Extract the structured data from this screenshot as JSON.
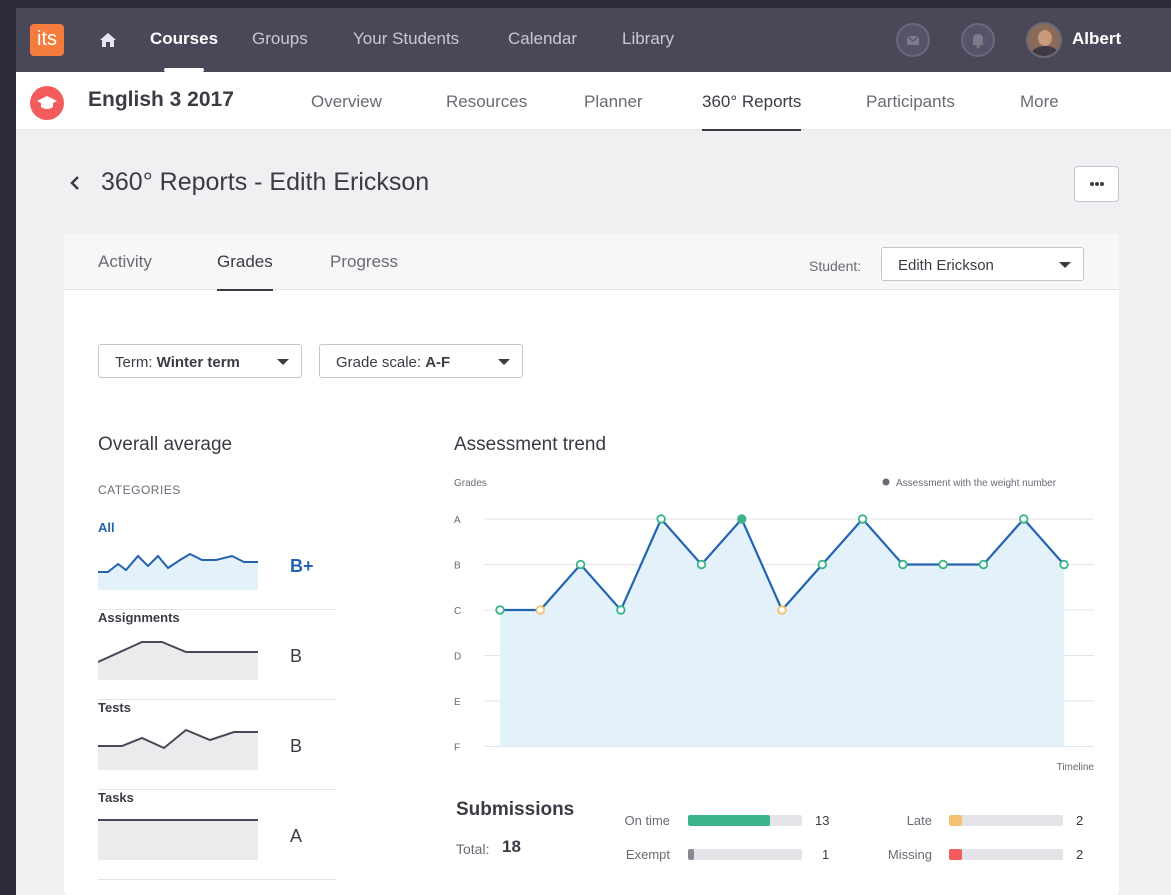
{
  "nav": {
    "logo": "its",
    "links": [
      "Courses",
      "Groups",
      "Your Students",
      "Calendar",
      "Library"
    ],
    "active": "Courses",
    "user": "Albert"
  },
  "course": {
    "title": "English 3 2017",
    "tabs": [
      "Overview",
      "Resources",
      "Planner",
      "360° Reports",
      "Participants",
      "More"
    ],
    "active": "360° Reports"
  },
  "page": {
    "title": "360° Reports - Edith Erickson"
  },
  "report_tabs": [
    "Activity",
    "Grades",
    "Progress"
  ],
  "report_active": "Grades",
  "student": {
    "label": "Student:",
    "value": "Edith Erickson"
  },
  "filters": {
    "term_label": "Term:",
    "term_value": "Winter term",
    "scale_label": "Grade scale:",
    "scale_value": "A-F"
  },
  "overall": {
    "title": "Overall average",
    "caption": "CATEGORIES",
    "categories": [
      {
        "name": "All",
        "grade": "B+"
      },
      {
        "name": "Assignments",
        "grade": "B"
      },
      {
        "name": "Tests",
        "grade": "B"
      },
      {
        "name": "Tasks",
        "grade": "A"
      }
    ]
  },
  "colors": {
    "accent_blue": "#2463b0",
    "on_time": "#3ab58a",
    "late": "#f5c272",
    "missing": "#f25c5c",
    "exempt": "#8a8892",
    "logo": "#f47c3c"
  },
  "chart_data": {
    "type": "line",
    "title": "Assessment trend",
    "ylabel": "Grades",
    "xlabel": "Timeline",
    "legend": "Assessment with the weight number",
    "y_ticks": [
      "A",
      "B",
      "C",
      "D",
      "E",
      "F"
    ],
    "series": [
      {
        "values": [
          "C",
          "C",
          "B",
          "C",
          "A",
          "B",
          "A",
          "C",
          "B",
          "A",
          "B",
          "B",
          "B",
          "A",
          "B"
        ]
      }
    ],
    "late_points": [
      1,
      7
    ],
    "weighted_points": [
      6
    ]
  },
  "submissions": {
    "title": "Submissions",
    "total_label": "Total:",
    "total": 18,
    "rows": [
      {
        "label": "On time",
        "count": 13,
        "fraction": 0.72
      },
      {
        "label": "Exempt",
        "count": 1,
        "fraction": 0.05
      },
      {
        "label": "Late",
        "count": 2,
        "fraction": 0.11
      },
      {
        "label": "Missing",
        "count": 2,
        "fraction": 0.11
      }
    ]
  }
}
